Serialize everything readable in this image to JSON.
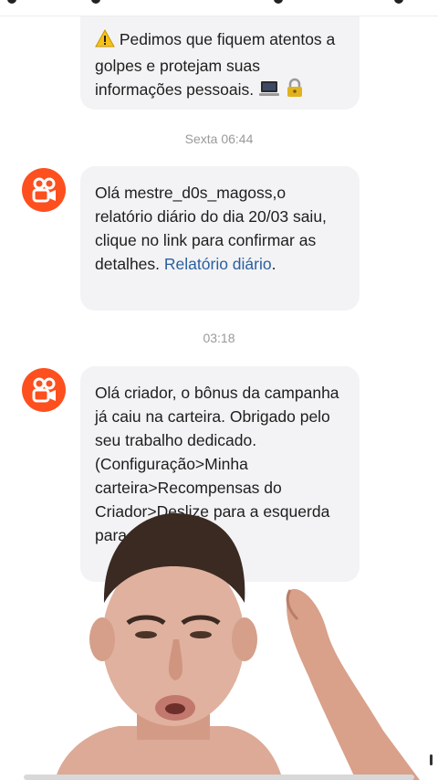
{
  "messages": [
    {
      "text": "Pedimos que fiquem atentos a golpes e protejam suas informações pessoais.",
      "lead_icon": "warning-icon",
      "trail_icons": [
        "laptop-icon",
        "lock-icon"
      ]
    },
    {
      "timestamp": "Sexta 06:44",
      "sender_icon": "kwai-logo-icon",
      "text": "Olá mestre_d0s_magoss,o relatório diário do dia 20/03 saiu, clique no link para confirmar as detalhes.",
      "link": "Relatório diário",
      "tail": "."
    },
    {
      "timestamp": "03:18",
      "sender_icon": "kwai-logo-icon",
      "text": "Olá criador, o bônus da campanha já caiu na carteira. Obrigado pelo seu trabalho dedicado. (Configuração>Minha carteira>Recompensas do Criador>Deslize para a esquerda para segunda ca..."
    }
  ],
  "colors": {
    "accent": "#fe4f1e",
    "link": "#2a5f9e",
    "bubble": "#f3f3f5"
  }
}
